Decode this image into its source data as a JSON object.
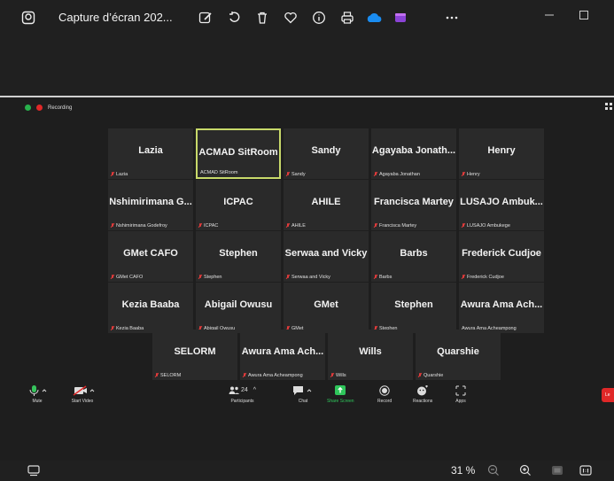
{
  "titlebar": {
    "title": "Capture d’écran 202..."
  },
  "recording": {
    "label": "Recording"
  },
  "tiles": [
    {
      "name": "Lazia",
      "label": "Lazia",
      "muted": true
    },
    {
      "name": "ACMAD SitRoom",
      "label": "ACMAD SitRoom",
      "muted": false,
      "active": true
    },
    {
      "name": "Sandy",
      "label": "Sandy",
      "muted": true
    },
    {
      "name": "Agayaba Jonath...",
      "label": "Agayaba Jonathan",
      "muted": true
    },
    {
      "name": "Henry",
      "label": "Henry",
      "muted": true
    },
    {
      "name": "Nshimirimana G...",
      "label": "Nshimirimana Godefroy",
      "muted": true
    },
    {
      "name": "ICPAC",
      "label": "ICPAC",
      "muted": true
    },
    {
      "name": "AHILE",
      "label": "AHILE",
      "muted": true
    },
    {
      "name": "Francisca Martey",
      "label": "Francisca Martey",
      "muted": true
    },
    {
      "name": "LUSAJO Ambuk...",
      "label": "LUSAJO Ambukege",
      "muted": true
    },
    {
      "name": "GMet CAFO",
      "label": "GMet CAFO",
      "muted": true
    },
    {
      "name": "Stephen",
      "label": "Stephen",
      "muted": true
    },
    {
      "name": "Serwaa and Vicky",
      "label": "Serwaa and Vicky",
      "muted": true
    },
    {
      "name": "Barbs",
      "label": "Barbs",
      "muted": true
    },
    {
      "name": "Frederick Cudjoe",
      "label": "Frederick Cudjoe",
      "muted": true
    },
    {
      "name": "Kezia Baaba",
      "label": "Kezia Baaba",
      "muted": true
    },
    {
      "name": "Abigail Owusu",
      "label": "Abigail Owusu",
      "muted": true
    },
    {
      "name": "GMet",
      "label": "GMet",
      "muted": true
    },
    {
      "name": "Stephen",
      "label": "Stephen",
      "muted": true
    },
    {
      "name": "Awura Ama Ach...",
      "label": "Awura Ama Acheampong",
      "muted": false
    },
    {
      "name": "SELORM",
      "label": "SELORM",
      "muted": true
    },
    {
      "name": "Awura Ama Ach...",
      "label": "Awura Ama Acheampong",
      "muted": true
    },
    {
      "name": "Wills",
      "label": "Wills",
      "muted": true
    },
    {
      "name": "Quarshie",
      "label": "Quarshie",
      "muted": true
    }
  ],
  "toolbar": {
    "mute": "Mute",
    "start_video": "Start Video",
    "participants": "Participants",
    "participants_count": "24",
    "chat": "Chat",
    "share_screen": "Share Screen",
    "record": "Record",
    "reactions": "Reactions",
    "apps": "Apps",
    "leave": "Le"
  },
  "bottombar": {
    "zoom_level": "31 %"
  },
  "colors": {
    "active_border": "#c8d96a",
    "share_green": "#2fc65b",
    "leave_red": "#e02828"
  }
}
